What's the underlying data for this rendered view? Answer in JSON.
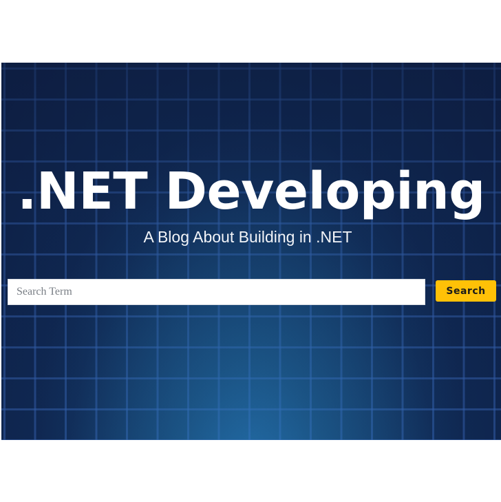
{
  "header": {
    "title": ".NET Developing",
    "subtitle": "A Blog About Building in .NET"
  },
  "search": {
    "placeholder": "Search Term",
    "value": "",
    "button_label": "Search"
  },
  "colors": {
    "hero_background": "#0d1f45",
    "grid_lines": "#3e6ec4",
    "search_button": "#ffc107",
    "title_text": "#ffffff"
  }
}
